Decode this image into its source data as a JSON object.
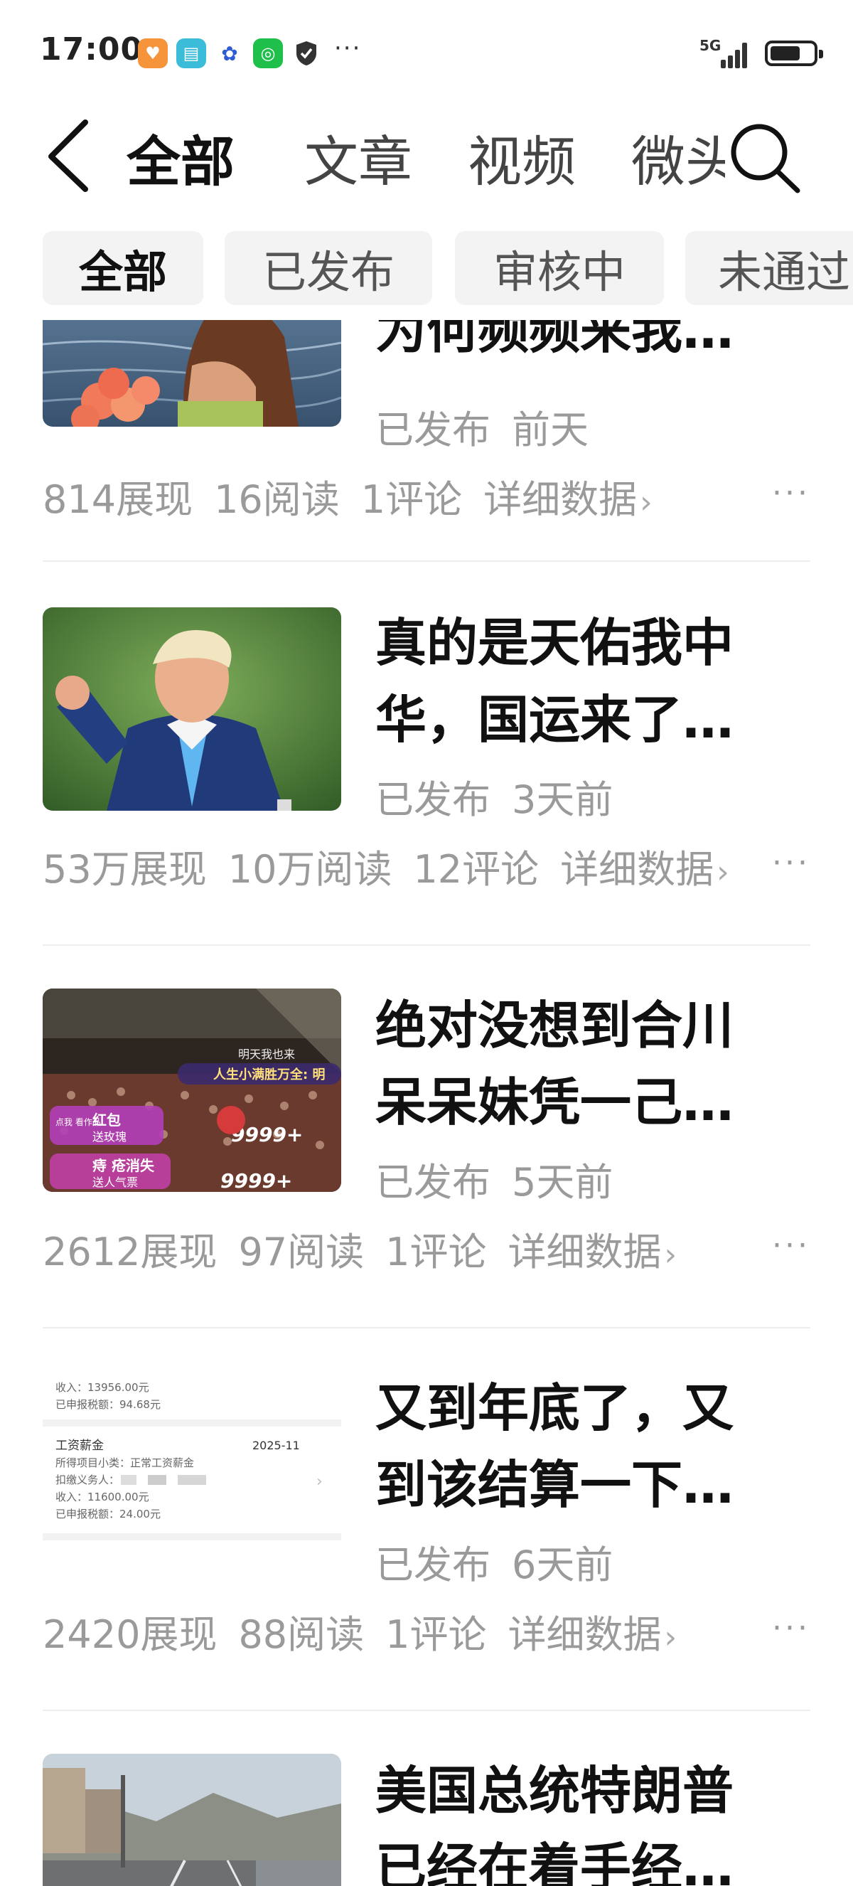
{
  "status_bar": {
    "time": "17:00",
    "network": "5G",
    "apps": [
      {
        "icon": "heart-app-icon",
        "color": "#f5943a",
        "glyph": "♥"
      },
      {
        "icon": "book-app-icon",
        "color": "#3bbcd8",
        "glyph": "▤"
      },
      {
        "icon": "baidu-icon",
        "color": "#ffffff",
        "glyph": "🐾"
      },
      {
        "icon": "wechat-icon",
        "color": "#1fbf4b",
        "glyph": "◎"
      },
      {
        "icon": "shield-icon",
        "color": "#333333",
        "glyph": "✓"
      }
    ],
    "more": "···",
    "battery_level": 0.7
  },
  "header": {
    "tabs": [
      {
        "label": "全部",
        "active": true
      },
      {
        "label": "文章",
        "active": false
      },
      {
        "label": "视频",
        "active": false
      },
      {
        "label": "微头",
        "active": false
      }
    ]
  },
  "filters": [
    {
      "label": "全部",
      "active": true
    },
    {
      "label": "已发布",
      "active": false
    },
    {
      "label": "审核中",
      "active": false
    },
    {
      "label": "未通过",
      "active": false
    }
  ],
  "articles": [
    {
      "title_lines": [
        "为何频频来我…"
      ],
      "status": "已发布",
      "time": "前天",
      "stats": [
        "814展现",
        "16阅读",
        "1评论"
      ],
      "detail_label": "详细数据",
      "more": "···"
    },
    {
      "title_lines": [
        "真的是天佑我中",
        "华，国运来了…"
      ],
      "status": "已发布",
      "time": "3天前",
      "stats": [
        "53万展现",
        "10万阅读",
        "12评论"
      ],
      "detail_label": "详细数据",
      "more": "···"
    },
    {
      "title_lines": [
        "绝对没想到合川",
        "呆呆妹凭一己…"
      ],
      "status": "已发布",
      "time": "5天前",
      "stats": [
        "2612展现",
        "97阅读",
        "1评论"
      ],
      "detail_label": "详细数据",
      "more": "···",
      "thumb_text": {
        "banner": "人生小满胜万全: 明",
        "top": "明天我也来",
        "badge1": "红包",
        "badge1_sub": "送玫瑰",
        "tag1": "点我 看作品",
        "badge2": "痔 疮消失",
        "badge2_sub": "送人气票",
        "count1": "9999+",
        "count2": "9999+"
      }
    },
    {
      "title_lines": [
        "又到年底了，又",
        "到该结算一下…"
      ],
      "status": "已发布",
      "time": "6天前",
      "stats": [
        "2420展现",
        "88阅读",
        "1评论"
      ],
      "detail_label": "详细数据",
      "more": "···",
      "thumb_text": {
        "income1": "收入：13956.00元",
        "tax1": "已申报税额：94.68元",
        "item_title": "工资薪金",
        "month": "2025-11",
        "subtype": "所得项目小类：正常工资薪金",
        "payer": "扣缴义务人：",
        "income2": "收入：11600.00元",
        "tax2": "已申报税额：24.00元"
      }
    },
    {
      "title_lines": [
        "美国总统特朗普",
        "已经在着手经…"
      ],
      "status": "",
      "time": "",
      "stats": [],
      "detail_label": "",
      "more": ""
    }
  ]
}
